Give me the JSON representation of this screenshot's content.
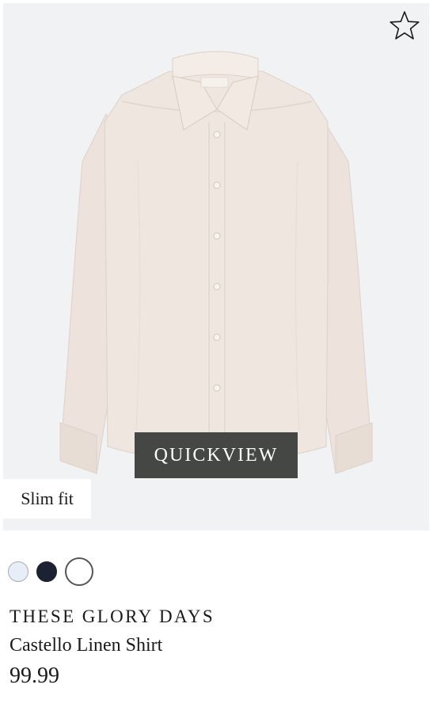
{
  "product": {
    "fit_label": "Slim fit",
    "quickview_label": "QUICKVIEW",
    "brand": "THESE GLORY DAYS",
    "name": "Castello Linen Shirt",
    "price": "99.99",
    "image_icon": "linen-shirt-photo",
    "favorite_icon": "star-outline-icon"
  },
  "swatches": [
    {
      "name": "light-blue",
      "color": "#e8eef8"
    },
    {
      "name": "navy",
      "color": "#1c2233"
    },
    {
      "name": "white",
      "color": "#ffffff",
      "selected": true
    }
  ],
  "colors": {
    "image_background": "#f0f2f4",
    "quickview_background": "#454745",
    "shirt": "#efe6df"
  }
}
